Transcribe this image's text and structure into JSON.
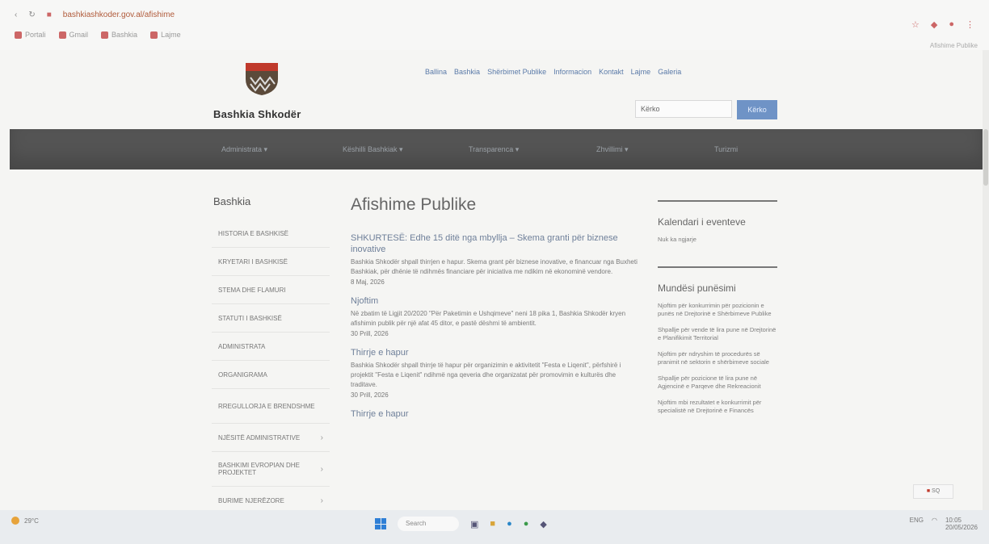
{
  "browser": {
    "tab_title": "Afishime Publike",
    "url": "bashkiashkoder.gov.al/afishime",
    "bookmarks": [
      "Portali",
      "Gmail",
      "Bashkia",
      "Lajme"
    ],
    "accent": "#c0392b"
  },
  "site": {
    "name": "Bashkia Shkodër",
    "top_links": [
      "Ballina",
      "Bashkia",
      "Shërbimet Publike",
      "Informacion",
      "Kontakt",
      "Lajme",
      "Galeria"
    ],
    "search_placeholder": "Kërko",
    "search_button": "Kërko"
  },
  "main_nav": [
    "Administrata",
    "Këshilli Bashkiak",
    "Transparenca",
    "Zhvillimi",
    "Turizmi"
  ],
  "sidebar": {
    "title": "Bashkia",
    "items": [
      {
        "label": "HISTORIA E BASHKISË",
        "chevron": ""
      },
      {
        "label": "KRYETARI I BASHKISË",
        "chevron": ""
      },
      {
        "label": "STEMA DHE FLAMURI",
        "chevron": ""
      },
      {
        "label": "STATUTI I BASHKISË",
        "chevron": ""
      },
      {
        "label": "ADMINISTRATA",
        "chevron": ""
      },
      {
        "label": "ORGANIGRAMA",
        "chevron": ""
      },
      {
        "label": "RREGULLORJA E BRENDSHME",
        "chevron": ""
      },
      {
        "label": "NJËSITË ADMINISTRATIVE",
        "chevron": "›"
      },
      {
        "label": "BASHKIMI EVROPIAN DHE PROJEKTET",
        "chevron": "›"
      },
      {
        "label": "BURIME NJERËZORE",
        "chevron": "›"
      }
    ]
  },
  "content": {
    "page_title": "Afishime Publike",
    "posts": [
      {
        "title": "SHKURTESË: Edhe 15 ditë nga mbyllja – Skema granti për biznese inovative",
        "body": "Bashkia Shkodër shpall thirrjen e hapur. Skema grant për biznese inovative, e financuar nga Buxheti Bashkiak, për dhënie të ndihmës financiare për iniciativa me ndikim në ekonominë vendore.",
        "date": "8 Maj, 2026"
      },
      {
        "title": "Njoftim",
        "body": "Në zbatim të Ligjit 20/2020 \"Për Paketimin e Ushqimeve\" neni 18 pika 1, Bashkia Shkodër kryen afishimin publik për një afat 45 ditor, e pastë dëshmi të ambientit.",
        "date": "30 Prill, 2026"
      },
      {
        "title": "Thirrje e hapur",
        "body": "Bashkia Shkodër shpall thirrje të hapur për organizimin e aktivitetit \"Festa e Liqenit\", përfshirë i projektit \"Festa e Liqenit\" ndihmë nga qeveria dhe organizatat për promovimin e kulturës dhe traditave.",
        "date": "30 Prill, 2026"
      },
      {
        "title": "Thirrje e hapur",
        "body": "",
        "date": ""
      }
    ]
  },
  "right": {
    "calendar_title": "Kalendari i eventeve",
    "calendar_text": "Nuk ka ngjarje",
    "jobs_title": "Mundësi punësimi",
    "jobs": [
      "Njoftim për konkurrimin për pozicionin e punës në Drejtorinë e Shërbimeve Publike",
      "Shpallje për vende të lira pune në Drejtorinë e Planifikimit Territorial",
      "Njoftim për ndryshim të procedurës së pranimit në sektorin e shërbimeve sociale",
      "Shpallje për pozicione të lira pune në Agjencinë e Parqeve dhe Rekreacionit",
      "Njoftim mbi rezultatet e konkurrimit për specialistë në Drejtorinë e Financës"
    ]
  },
  "language_switch": "SQ",
  "taskbar": {
    "weather": "29°C",
    "search_label": "Search",
    "tray_language": "ENG",
    "time": "10:05",
    "date": "20/05/2026"
  }
}
